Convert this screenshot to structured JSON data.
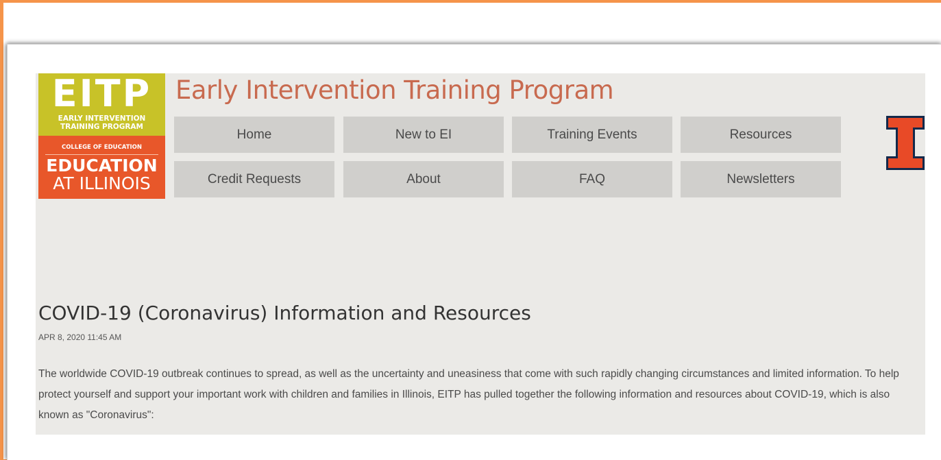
{
  "site": {
    "title": "Early Intervention Training Program"
  },
  "logo": {
    "acronym": "EITP",
    "sub_line1": "EARLY INTERVENTION",
    "sub_line2": "TRAINING PROGRAM",
    "college": "COLLEGE OF EDUCATION",
    "education": "EDUCATION",
    "at_illinois": "AT ILLINOIS"
  },
  "nav": {
    "items": [
      {
        "label": "Home"
      },
      {
        "label": "New to EI"
      },
      {
        "label": "Training Events"
      },
      {
        "label": "Resources"
      },
      {
        "label": "Credit Requests"
      },
      {
        "label": "About"
      },
      {
        "label": "FAQ"
      },
      {
        "label": "Newsletters"
      }
    ]
  },
  "article": {
    "title": "COVID-19 (Coronavirus) Information and Resources",
    "date": "APR 8, 2020 11:45 AM",
    "body": "The worldwide COVID-19 outbreak continues to spread, as well as the uncertainty and uneasiness that come with such rapidly changing circumstances and limited information. To help protect yourself and support your important work with children and families in Illinois, EITP has pulled together the following information and resources about COVID-19, which is also known as \"Coronavirus\":"
  },
  "colors": {
    "frame_orange": "#f5944a",
    "logo_yellow": "#c8c228",
    "logo_orange": "#e8572a",
    "title_color": "#c86a4f",
    "nav_bg": "#d0cfcc",
    "content_bg": "#ebeae7",
    "illinois_orange": "#e84a27",
    "illinois_navy": "#13294b"
  },
  "icons": {
    "university_mark": "illinois-block-i-icon"
  }
}
